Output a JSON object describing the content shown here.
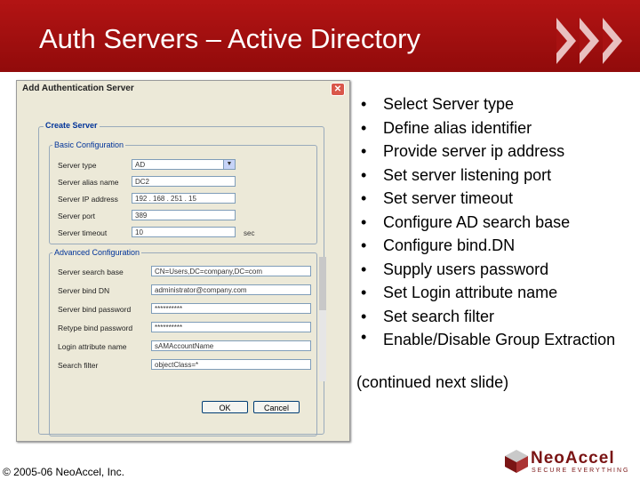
{
  "slide": {
    "title": "Auth Servers – Active Directory"
  },
  "dialog": {
    "title": "Add Authentication Server",
    "create_server_legend": "Create Server",
    "basic_legend": "Basic Configuration",
    "advanced_legend": "Advanced Configuration",
    "basic_fields": [
      {
        "label": "Server type",
        "value": "AD"
      },
      {
        "label": "Server alias name",
        "value": "DC2"
      },
      {
        "label": "Server IP address",
        "value": "192 . 168 . 251 . 15"
      },
      {
        "label": "Server port",
        "value": "389"
      },
      {
        "label": "Server timeout",
        "value": "10",
        "unit": "sec"
      }
    ],
    "advanced_fields": [
      {
        "label": "Server search base",
        "value": "CN=Users,DC=company,DC=com"
      },
      {
        "label": "Server bind DN",
        "value": "administrator@company.com"
      },
      {
        "label": "Server bind password",
        "value": "**********"
      },
      {
        "label": "Retype bind password",
        "value": "**********"
      },
      {
        "label": "Login attribute name",
        "value": "sAMAccountName"
      },
      {
        "label": "Search filter",
        "value": "objectClass=*"
      }
    ],
    "ok_label": "OK",
    "cancel_label": "Cancel"
  },
  "bullets": [
    "Select Server type",
    "Define alias identifier",
    "Provide server ip address",
    "Set server listening port",
    "Set server timeout",
    "Configure AD search base",
    "Configure bind.DN",
    "Supply users password",
    "Set Login attribute name",
    "Set search filter",
    "Enable/Disable Group Extraction"
  ],
  "continued_note": "(continued next slide)",
  "footer": {
    "copyright": "© 2005-06 NeoAccel, Inc.",
    "logo_name": "NeoAccel",
    "logo_tagline": "SECURE EVERYTHING"
  },
  "colors": {
    "banner": "#a81212",
    "logo": "#7a1414",
    "legend_text": "#003399"
  }
}
